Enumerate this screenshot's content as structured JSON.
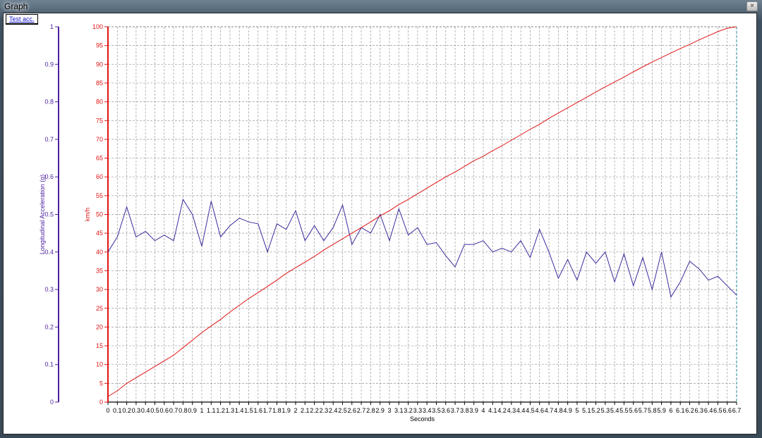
{
  "window": {
    "title": "Graph",
    "close_glyph": "×"
  },
  "tab": {
    "label": "Test acc."
  },
  "chart_data": {
    "type": "line",
    "xlabel": "Seconds",
    "x_ticks": [
      "0",
      "0.1",
      "0.2",
      "0.3",
      "0.4",
      "0.5",
      "0.6",
      "0.7",
      "0.8",
      "0.9",
      "1",
      "1.1",
      "1.2",
      "1.3",
      "1.4",
      "1.5",
      "1.6",
      "1.7",
      "1.8",
      "1.9",
      "2",
      "2.1",
      "2.2",
      "2.3",
      "2.4",
      "2.5",
      "2.6",
      "2.7",
      "2.8",
      "2.9",
      "3",
      "3.1",
      "3.2",
      "3.3",
      "3.4",
      "3.5",
      "3.6",
      "3.7",
      "3.8",
      "3.9",
      "4",
      "4.1",
      "4.2",
      "4.3",
      "4.4",
      "4.5",
      "4.6",
      "4.7",
      "4.8",
      "4.9",
      "5",
      "5.1",
      "5.2",
      "5.3",
      "5.4",
      "5.5",
      "5.6",
      "5.7",
      "5.8",
      "5.9",
      "6",
      "6.1",
      "6.2",
      "6.3",
      "6.4",
      "6.5",
      "6.6",
      "6.7"
    ],
    "xlim": [
      0,
      6.7
    ],
    "grid": true,
    "left_axis": {
      "label": "Longitudinal Acceleration (g)",
      "lim": [
        0,
        1
      ],
      "ticks": [
        "0",
        "0.1",
        "0.2",
        "0.3",
        "0.4",
        "0.5",
        "0.6",
        "0.7",
        "0.8",
        "0.9",
        "1"
      ],
      "color": "#4b1fa0"
    },
    "right_axis": {
      "label": "km/h",
      "lim": [
        0,
        100
      ],
      "ticks": [
        "0",
        "5",
        "10",
        "15",
        "20",
        "25",
        "30",
        "35",
        "40",
        "45",
        "50",
        "55",
        "60",
        "65",
        "70",
        "75",
        "80",
        "85",
        "90",
        "95",
        "100"
      ],
      "color": "#e01414"
    },
    "series": [
      {
        "axis": "left",
        "color": "#3c2c9c",
        "values": [
          0.4,
          0.44,
          0.52,
          0.44,
          0.455,
          0.43,
          0.445,
          0.43,
          0.54,
          0.5,
          0.415,
          0.535,
          0.44,
          0.47,
          0.49,
          0.48,
          0.475,
          0.4,
          0.475,
          0.46,
          0.51,
          0.43,
          0.47,
          0.43,
          0.465,
          0.525,
          0.42,
          0.465,
          0.45,
          0.5,
          0.43,
          0.515,
          0.445,
          0.465,
          0.42,
          0.425,
          0.39,
          0.36,
          0.42,
          0.42,
          0.43,
          0.4,
          0.41,
          0.4,
          0.43,
          0.385,
          0.46,
          0.4,
          0.33,
          0.38,
          0.325,
          0.4,
          0.37,
          0.4,
          0.32,
          0.395,
          0.31,
          0.385,
          0.3,
          0.4,
          0.28,
          0.32,
          0.375,
          0.355,
          0.325,
          0.335,
          0.31,
          0.285
        ]
      },
      {
        "axis": "right",
        "color": "#e01414",
        "values": [
          1.5,
          3,
          5,
          6.5,
          8,
          9.5,
          11,
          12.5,
          14.5,
          16.5,
          18.5,
          20.3,
          22,
          24,
          25.8,
          27.6,
          29.2,
          30.8,
          32.5,
          34.3,
          35.8,
          37.3,
          38.8,
          40.5,
          42,
          43.5,
          45,
          46.5,
          48,
          49.6,
          51,
          52.6,
          54,
          55.5,
          57,
          58.5,
          60,
          61.3,
          62.8,
          64.3,
          65.5,
          67,
          68.3,
          69.8,
          71.2,
          72.7,
          74,
          75.6,
          77,
          78.4,
          79.8,
          81.2,
          82.6,
          84,
          85.3,
          86.6,
          88,
          89.3,
          90.6,
          91.8,
          93,
          94.2,
          95.3,
          96.5,
          97.6,
          98.7,
          99.6,
          100
        ]
      }
    ]
  }
}
